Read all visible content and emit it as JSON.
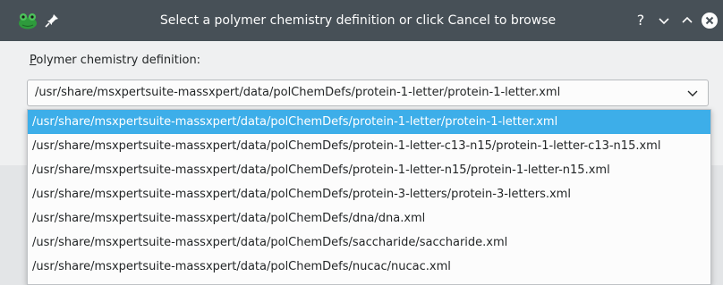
{
  "titlebar": {
    "title": "Select a polymer chemistry definition or click Cancel to browse",
    "help_label": "?"
  },
  "icons": {
    "app": "frog-app-icon",
    "pin": "pin-icon",
    "minimize": "chevron-down-icon",
    "maximize": "chevron-up-icon",
    "close": "close-icon"
  },
  "form": {
    "label_mnemonic": "P",
    "label_rest": "olymer chemistry definition:",
    "selected_value": "/usr/share/msxpertsuite-massxpert/data/polChemDefs/protein-1-letter/protein-1-letter.xml"
  },
  "options": [
    "/usr/share/msxpertsuite-massxpert/data/polChemDefs/protein-1-letter/protein-1-letter.xml",
    "/usr/share/msxpertsuite-massxpert/data/polChemDefs/protein-1-letter-c13-n15/protein-1-letter-c13-n15.xml",
    "/usr/share/msxpertsuite-massxpert/data/polChemDefs/protein-1-letter-n15/protein-1-letter-n15.xml",
    "/usr/share/msxpertsuite-massxpert/data/polChemDefs/protein-3-letters/protein-3-letters.xml",
    "/usr/share/msxpertsuite-massxpert/data/polChemDefs/dna/dna.xml",
    "/usr/share/msxpertsuite-massxpert/data/polChemDefs/saccharide/saccharide.xml",
    "/usr/share/msxpertsuite-massxpert/data/polChemDefs/nucac/nucac.xml"
  ],
  "selected_index": 0,
  "colors": {
    "titlebar": "#475057",
    "highlight": "#3daee9",
    "window": "#eff0f1"
  }
}
